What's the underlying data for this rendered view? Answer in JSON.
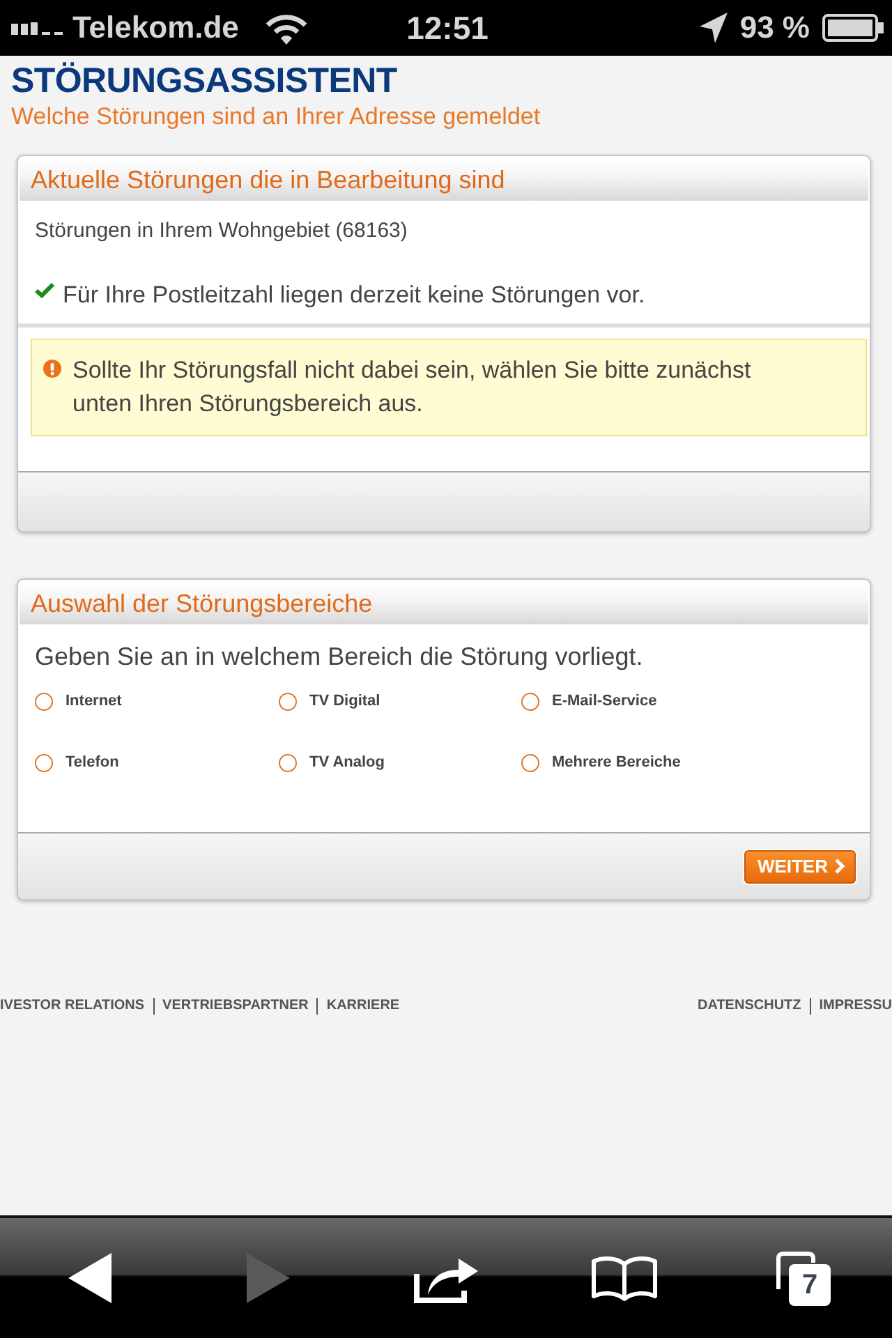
{
  "status_bar": {
    "carrier": "Telekom.de",
    "time": "12:51",
    "battery": "93 %"
  },
  "header": {
    "title": "STÖRUNGSASSISTENT",
    "subtitle": "Welche Störungen sind an Ihrer Adresse gemeldet"
  },
  "current_outages": {
    "title": "Aktuelle Störungen die in Bearbeitung sind",
    "area": "Störungen in Ihrem Wohngebiet (68163)",
    "status": "Für Ihre Postleitzahl liegen derzeit keine Störungen vor.",
    "notice": "Sollte Ihr Störungsfall nicht dabei sein, wählen Sie bitte zunächst unten Ihren Störungsbereich aus."
  },
  "area_selection": {
    "title": "Auswahl der Störungsbereiche",
    "prompt": "Geben Sie an in welchem Bereich die Störung vorliegt.",
    "options": [
      {
        "label": "Internet",
        "selected": false
      },
      {
        "label": "TV Digital",
        "selected": false
      },
      {
        "label": "E-Mail-Service",
        "selected": false
      },
      {
        "label": "Telefon",
        "selected": false
      },
      {
        "label": "TV Analog",
        "selected": false
      },
      {
        "label": "Mehrere Bereiche",
        "selected": false
      }
    ],
    "button": "WEITER"
  },
  "footer": {
    "left_links": [
      "IVESTOR RELATIONS",
      "VERTRIEBSPARTNER",
      "KARRIERE"
    ],
    "right_links": [
      "DATENSCHUTZ",
      "IMPRESSU"
    ]
  },
  "toolbar": [
    {
      "kind": "back",
      "disabled": false
    },
    {
      "kind": "forward",
      "disabled": true
    },
    {
      "kind": "share",
      "disabled": false
    },
    {
      "kind": "bookmarks",
      "disabled": false
    },
    {
      "kind": "tabs",
      "disabled": false,
      "count": "7"
    }
  ]
}
